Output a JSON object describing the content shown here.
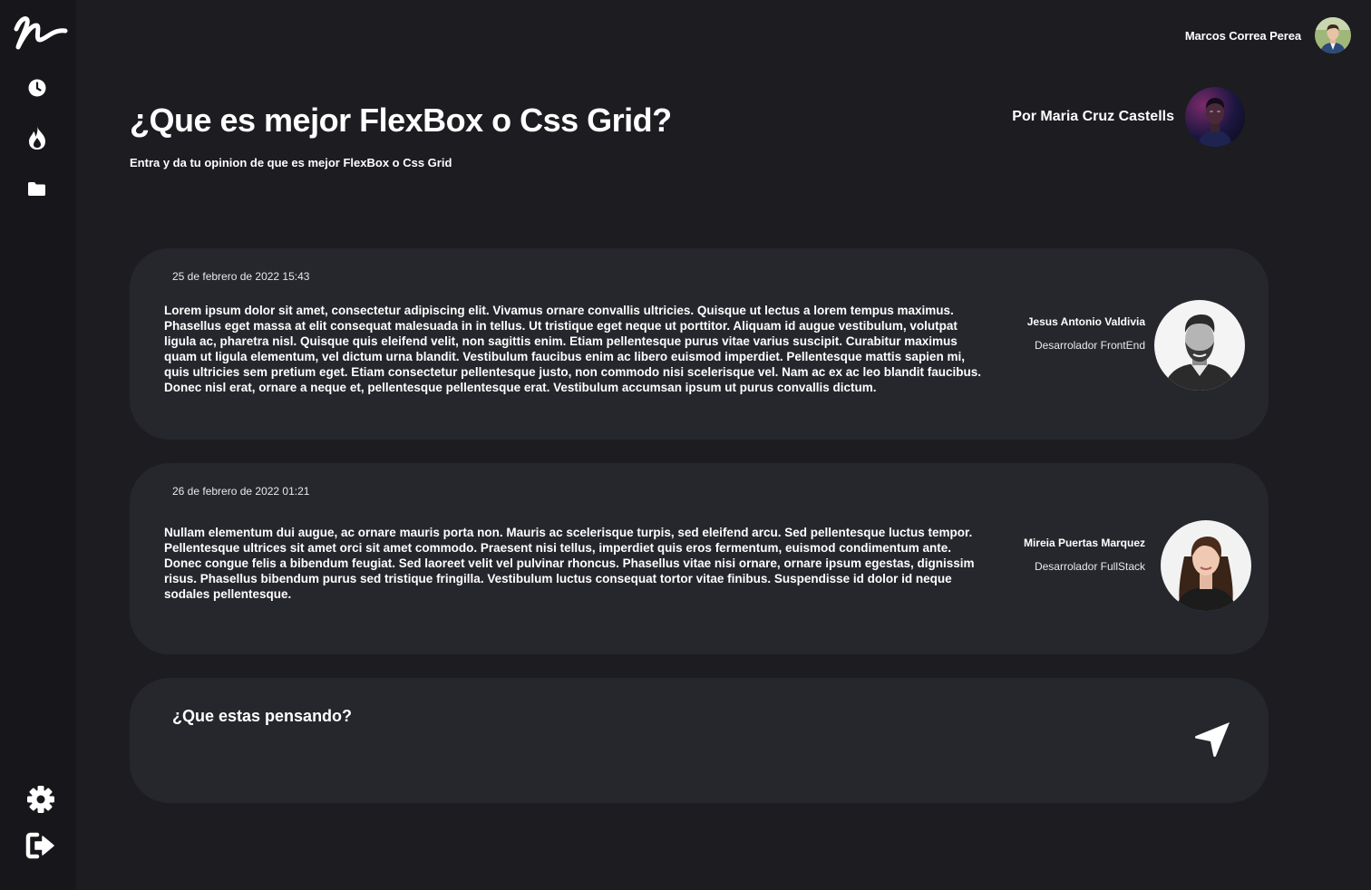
{
  "app": {
    "logo_icon": "signature-logo-icon"
  },
  "sidebar": {
    "items": [
      {
        "icon": "clock-icon",
        "label": "recent"
      },
      {
        "icon": "flame-icon",
        "label": "trending"
      },
      {
        "icon": "folder-icon",
        "label": "folders"
      }
    ],
    "bottom_items": [
      {
        "icon": "gear-icon",
        "label": "settings"
      },
      {
        "icon": "logout-icon",
        "label": "logout"
      }
    ]
  },
  "user": {
    "name": "Marcos Correa Perea",
    "avatar_icon": "user-avatar"
  },
  "post": {
    "title": "¿Que es mejor FlexBox o Css Grid?",
    "subtitle": "Entra y da tu opinion de que es mejor FlexBox o Css Grid",
    "author_line": "Por Maria Cruz Castells"
  },
  "comments": [
    {
      "date": "25 de febrero de 2022 15:43",
      "text": "Lorem ipsum dolor sit amet, consectetur adipiscing elit. Vivamus ornare convallis ultricies. Quisque ut lectus a lorem tempus maximus. Phasellus eget massa at elit consequat malesuada in in tellus. Ut tristique eget neque ut porttitor. Aliquam id augue vestibulum, volutpat ligula ac, pharetra nisl. Quisque quis eleifend velit, non sagittis enim. Etiam pellentesque purus vitae varius suscipit. Curabitur maximus quam ut ligula elementum, vel dictum urna blandit. Vestibulum faucibus enim ac libero euismod imperdiet. Pellentesque mattis sapien mi, quis ultricies sem pretium eget. Etiam consectetur pellentesque justo, non commodo nisi scelerisque vel. Nam ac ex ac leo blandit faucibus. Donec nisl erat, ornare a neque et, pellentesque pellentesque erat. Vestibulum accumsan ipsum ut purus convallis dictum.",
      "author_name": "Jesus Antonio Valdivia",
      "author_role": "Desarrolador FrontEnd"
    },
    {
      "date": "26 de febrero de 2022 01:21",
      "text": "Nullam elementum dui augue, ac ornare mauris porta non. Mauris ac scelerisque turpis, sed eleifend arcu. Sed pellentesque luctus tempor. Pellentesque ultrices sit amet orci sit amet commodo. Praesent nisi tellus, imperdiet quis eros fermentum, euismod condimentum ante. Donec congue felis a bibendum feugiat. Sed laoreet velit vel pulvinar rhoncus. Phasellus vitae nisi ornare, ornare ipsum egestas, dignissim risus. Phasellus bibendum purus sed tristique fringilla. Vestibulum luctus consequat tortor vitae finibus. Suspendisse id dolor id neque sodales pellentesque.",
      "author_name": "Mireia Puertas Marquez",
      "author_role": "Desarrolador FullStack"
    }
  ],
  "composer": {
    "placeholder": "¿Que estas pensando?",
    "send_icon": "send-icon"
  },
  "colors": {
    "background": "#1c1c21",
    "sidebar": "#17171b",
    "card": "#26262d",
    "text": "#ffffff"
  }
}
